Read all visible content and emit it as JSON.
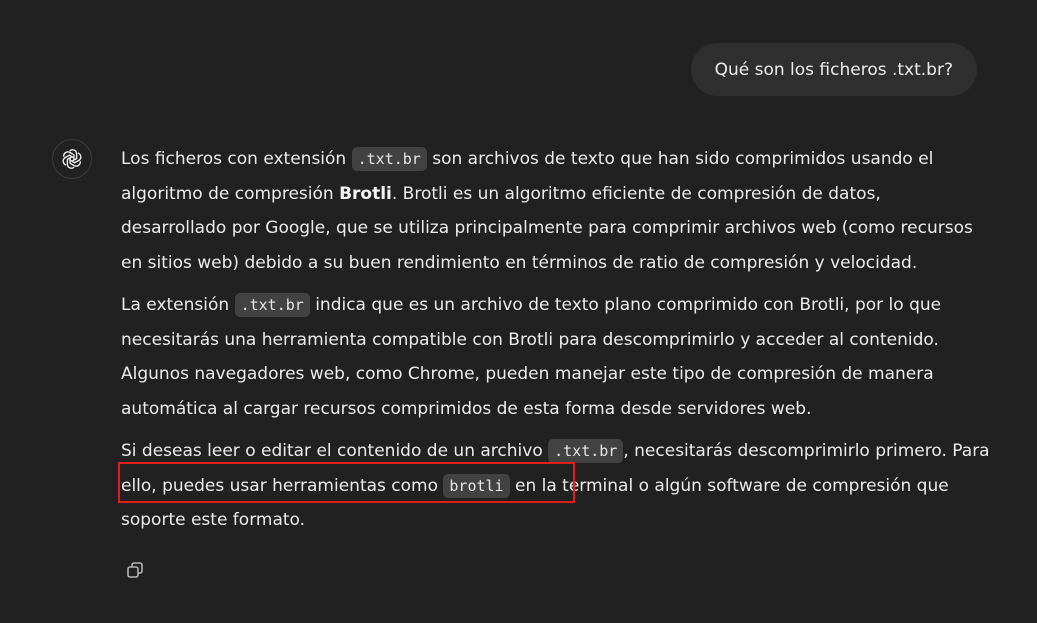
{
  "user_message": "Qué son los ficheros .txt.br?",
  "assistant": {
    "p1": {
      "t1": "Los ficheros con extensión ",
      "code1": ".txt.br",
      "t2": " son archivos de texto que han sido comprimidos usando el algoritmo de compresión ",
      "bold1": "Brotli",
      "t3": ". Brotli es un algoritmo eficiente de compresión de datos, desarrollado por Google, que se utiliza principalmente para comprimir archivos web (como recursos en sitios web) debido a su buen rendimiento en términos de ratio de compresión y velocidad."
    },
    "p2": {
      "t1": "La extensión ",
      "code1": ".txt.br",
      "t2": " indica que es un archivo de texto plano comprimido con Brotli, por lo que necesitarás una herramienta compatible con Brotli para descomprimirlo y acceder al contenido. Algunos navegadores web, como Chrome, pueden manejar este tipo de compresión de manera automática al cargar recursos comprimidos de esta forma desde servidores web."
    },
    "p3": {
      "t1": "Si deseas leer o editar el contenido de un archivo ",
      "code1": ".txt.br",
      "t2": ", necesitarás descomprimirlo primero. Para ello, puedes usar herramientas como ",
      "code2": "brotli",
      "t3": " en la terminal o algún software de compresión que soporte este formato."
    }
  },
  "icons": {
    "avatar": "openai-logo-icon",
    "copy": "copy-icon"
  },
  "colors": {
    "background": "#212121",
    "bubble": "#2f2f2f",
    "code_bg": "#424242",
    "text": "#ececec",
    "highlight": "#e31c1c"
  }
}
